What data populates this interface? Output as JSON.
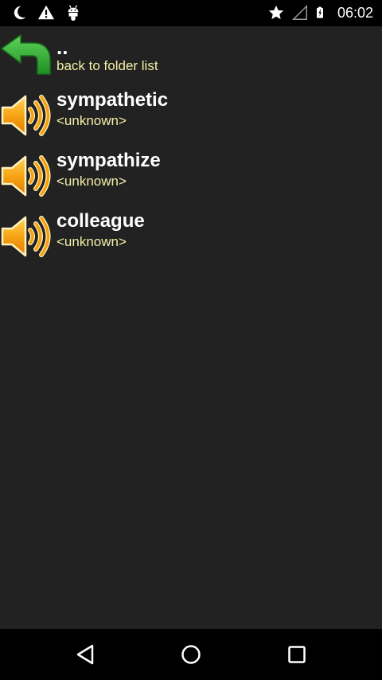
{
  "status_bar": {
    "left_icons": [
      "moon-icon",
      "warning-icon",
      "android-debug-icon"
    ],
    "right_icons": [
      "star-icon",
      "signal-icon",
      "battery-icon"
    ],
    "time": "06:02"
  },
  "list": {
    "back_item": {
      "title": "..",
      "subtitle": "back to folder list",
      "icon": "back-arrow-icon"
    },
    "items": [
      {
        "title": "sympathetic",
        "subtitle": "<unknown>",
        "icon": "speaker-icon"
      },
      {
        "title": "sympathize",
        "subtitle": "<unknown>",
        "icon": "speaker-icon"
      },
      {
        "title": "colleague",
        "subtitle": "<unknown>",
        "icon": "speaker-icon"
      }
    ]
  },
  "nav_bar": {
    "buttons": [
      "back-icon",
      "home-icon",
      "recents-icon"
    ]
  },
  "colors": {
    "background": "#222222",
    "bars": "#000000",
    "title": "#ffffff",
    "subtitle": "#f3efa6",
    "back_arrow": "#3cb53c",
    "speaker": "#f5a00c"
  }
}
